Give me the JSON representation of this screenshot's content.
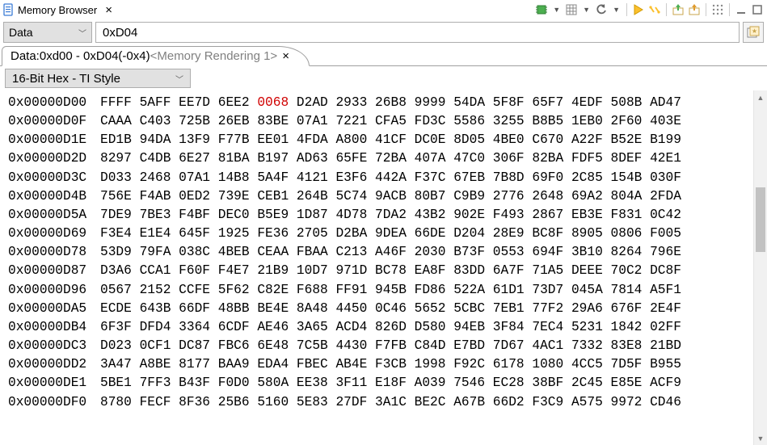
{
  "title": "Memory Browser",
  "toolbar_icons": [
    {
      "name": "chip-icon",
      "title": "Load/Connect"
    },
    {
      "name": "table-icon",
      "title": "View"
    },
    {
      "name": "refresh-icon",
      "title": "Refresh"
    },
    {
      "name": "play-yellow-icon",
      "title": "Continuous"
    },
    {
      "name": "pair-icon",
      "title": "Compare"
    },
    {
      "name": "import-icon",
      "title": "Import"
    },
    {
      "name": "export-icon",
      "title": "Export"
    },
    {
      "name": "cols-icon",
      "title": "Columns"
    },
    {
      "name": "minimize-icon",
      "title": "Minimize"
    },
    {
      "name": "maximize-icon",
      "title": "Maximize"
    }
  ],
  "region": {
    "label": "Data"
  },
  "address_value": "0xD04",
  "tab": {
    "prefix": "Data:0xd00 - 0xD04(-0x4) ",
    "gray": "<Memory Rendering 1>"
  },
  "format": {
    "label": "16-Bit Hex - TI Style"
  },
  "highlight": {
    "row": 0,
    "col": 4
  },
  "rows": [
    {
      "addr": "0x00000D00",
      "words": [
        "FFFF",
        "5AFF",
        "EE7D",
        "6EE2",
        "0068",
        "D2AD",
        "2933",
        "26B8",
        "9999",
        "54DA",
        "5F8F",
        "65F7",
        "4EDF",
        "508B",
        "AD47"
      ]
    },
    {
      "addr": "0x00000D0F",
      "words": [
        "CAAA",
        "C403",
        "725B",
        "26EB",
        "83BE",
        "07A1",
        "7221",
        "CFA5",
        "FD3C",
        "5586",
        "3255",
        "B8B5",
        "1EB0",
        "2F60",
        "403E"
      ]
    },
    {
      "addr": "0x00000D1E",
      "words": [
        "ED1B",
        "94DA",
        "13F9",
        "F77B",
        "EE01",
        "4FDA",
        "A800",
        "41CF",
        "DC0E",
        "8D05",
        "4BE0",
        "C670",
        "A22F",
        "B52E",
        "B199"
      ]
    },
    {
      "addr": "0x00000D2D",
      "words": [
        "8297",
        "C4DB",
        "6E27",
        "81BA",
        "B197",
        "AD63",
        "65FE",
        "72BA",
        "407A",
        "47C0",
        "306F",
        "82BA",
        "FDF5",
        "8DEF",
        "42E1"
      ]
    },
    {
      "addr": "0x00000D3C",
      "words": [
        "D033",
        "2468",
        "07A1",
        "14B8",
        "5A4F",
        "4121",
        "E3F6",
        "442A",
        "F37C",
        "67EB",
        "7B8D",
        "69F0",
        "2C85",
        "154B",
        "030F"
      ]
    },
    {
      "addr": "0x00000D4B",
      "words": [
        "756E",
        "F4AB",
        "0ED2",
        "739E",
        "CEB1",
        "264B",
        "5C74",
        "9ACB",
        "80B7",
        "C9B9",
        "2776",
        "2648",
        "69A2",
        "804A",
        "2FDA"
      ]
    },
    {
      "addr": "0x00000D5A",
      "words": [
        "7DE9",
        "7BE3",
        "F4BF",
        "DEC0",
        "B5E9",
        "1D87",
        "4D78",
        "7DA2",
        "43B2",
        "902E",
        "F493",
        "2867",
        "EB3E",
        "F831",
        "0C42"
      ]
    },
    {
      "addr": "0x00000D69",
      "words": [
        "F3E4",
        "E1E4",
        "645F",
        "1925",
        "FE36",
        "2705",
        "D2BA",
        "9DEA",
        "66DE",
        "D204",
        "28E9",
        "BC8F",
        "8905",
        "0806",
        "F005"
      ]
    },
    {
      "addr": "0x00000D78",
      "words": [
        "53D9",
        "79FA",
        "038C",
        "4BEB",
        "CEAA",
        "FBAA",
        "C213",
        "A46F",
        "2030",
        "B73F",
        "0553",
        "694F",
        "3B10",
        "8264",
        "796E"
      ]
    },
    {
      "addr": "0x00000D87",
      "words": [
        "D3A6",
        "CCA1",
        "F60F",
        "F4E7",
        "21B9",
        "10D7",
        "971D",
        "BC78",
        "EA8F",
        "83DD",
        "6A7F",
        "71A5",
        "DEEE",
        "70C2",
        "DC8F"
      ]
    },
    {
      "addr": "0x00000D96",
      "words": [
        "0567",
        "2152",
        "CCFE",
        "5F62",
        "C82E",
        "F688",
        "FF91",
        "945B",
        "FD86",
        "522A",
        "61D1",
        "73D7",
        "045A",
        "7814",
        "A5F1"
      ]
    },
    {
      "addr": "0x00000DA5",
      "words": [
        "ECDE",
        "643B",
        "66DF",
        "48BB",
        "BE4E",
        "8A48",
        "4450",
        "0C46",
        "5652",
        "5CBC",
        "7EB1",
        "77F2",
        "29A6",
        "676F",
        "2E4F"
      ]
    },
    {
      "addr": "0x00000DB4",
      "words": [
        "6F3F",
        "DFD4",
        "3364",
        "6CDF",
        "AE46",
        "3A65",
        "ACD4",
        "826D",
        "D580",
        "94EB",
        "3F84",
        "7EC4",
        "5231",
        "1842",
        "02FF"
      ]
    },
    {
      "addr": "0x00000DC3",
      "words": [
        "D023",
        "0CF1",
        "DC87",
        "FBC6",
        "6E48",
        "7C5B",
        "4430",
        "F7FB",
        "C84D",
        "E7BD",
        "7D67",
        "4AC1",
        "7332",
        "83E8",
        "21BD"
      ]
    },
    {
      "addr": "0x00000DD2",
      "words": [
        "3A47",
        "A8BE",
        "8177",
        "BAA9",
        "EDA4",
        "FBEC",
        "AB4E",
        "F3CB",
        "1998",
        "F92C",
        "6178",
        "1080",
        "4CC5",
        "7D5F",
        "B955"
      ]
    },
    {
      "addr": "0x00000DE1",
      "words": [
        "5BE1",
        "7FF3",
        "B43F",
        "F0D0",
        "580A",
        "EE38",
        "3F11",
        "E18F",
        "A039",
        "7546",
        "EC28",
        "38BF",
        "2C45",
        "E85E",
        "ACF9"
      ]
    },
    {
      "addr": "0x00000DF0",
      "words": [
        "8780",
        "FECF",
        "8F36",
        "25B6",
        "5160",
        "5E83",
        "27DF",
        "3A1C",
        "BE2C",
        "A67B",
        "66D2",
        "F3C9",
        "A575",
        "9972",
        "CD46"
      ]
    }
  ]
}
